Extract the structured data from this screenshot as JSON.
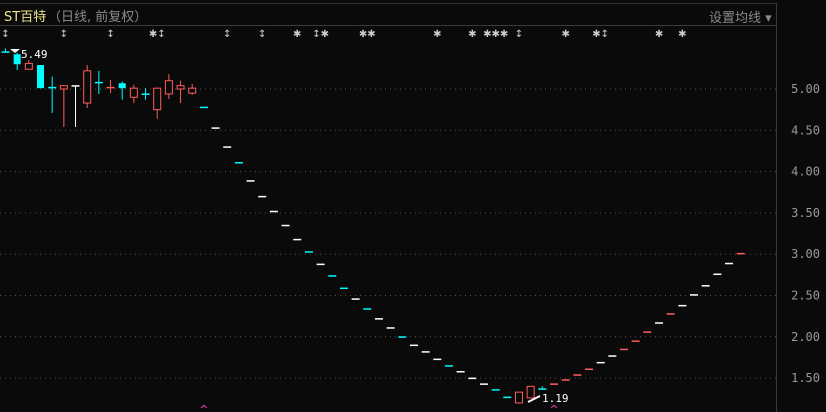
{
  "header": {
    "title": "ST百特",
    "subtitle": "（日线, 前复权）",
    "set_ma": "设置均线 ▾"
  },
  "colors": {
    "up": "#ff5c5c",
    "down": "#00ffff",
    "flat": "#ffffff",
    "grid": "#555555",
    "marker": "#ff40b0"
  },
  "chart_data": {
    "type": "candlestick",
    "yticks": [
      "5.00",
      "4.50",
      "4.00",
      "3.50",
      "3.00",
      "2.50",
      "2.00",
      "1.50"
    ],
    "ylim": [
      1.13,
      5.55
    ],
    "max_label": "5.49",
    "min_label": "1.19",
    "top_markers": [
      "↕",
      "",
      "",
      "",
      "",
      "↕",
      "",
      "",
      "",
      "↕",
      "",
      "",
      "",
      "✱↕",
      "",
      "",
      "",
      "",
      "",
      "↕",
      "",
      "",
      "↕",
      "",
      "",
      "✱",
      "",
      "↕✱",
      "",
      "",
      "",
      "✱✱",
      "",
      "",
      "",
      "",
      "",
      "✱",
      "",
      "",
      "✱",
      "",
      "✱✱✱",
      "",
      "↕",
      "",
      "",
      "",
      "✱",
      "",
      "",
      "✱↕",
      "",
      "",
      "",
      "",
      "✱",
      "",
      "✱",
      "",
      "",
      "",
      "",
      "",
      ""
    ],
    "bottom_markers": [
      17,
      47
    ],
    "candles": [
      [
        5.45,
        5.49,
        5.44,
        5.45,
        "down"
      ],
      [
        5.42,
        5.44,
        5.23,
        5.3,
        "down"
      ],
      [
        5.24,
        5.35,
        5.24,
        5.31,
        "up"
      ],
      [
        5.29,
        5.29,
        5.01,
        5.01,
        "down"
      ],
      [
        5.02,
        5.15,
        4.71,
        5.02,
        "down"
      ],
      [
        5.0,
        5.04,
        4.54,
        5.04,
        "up"
      ],
      [
        5.04,
        5.04,
        4.54,
        5.04,
        "flat"
      ],
      [
        4.83,
        5.29,
        4.77,
        5.22,
        "up"
      ],
      [
        5.08,
        5.22,
        4.94,
        5.08,
        "down"
      ],
      [
        5.02,
        5.11,
        4.95,
        5.02,
        "up"
      ],
      [
        5.07,
        5.09,
        4.87,
        5.01,
        "down"
      ],
      [
        4.9,
        5.05,
        4.83,
        5.01,
        "up"
      ],
      [
        4.94,
        5.01,
        4.87,
        4.94,
        "down"
      ],
      [
        4.75,
        5.01,
        4.64,
        5.01,
        "up"
      ],
      [
        4.94,
        5.18,
        4.88,
        5.1,
        "up"
      ],
      [
        5.0,
        5.1,
        4.83,
        5.04,
        "up"
      ],
      [
        4.95,
        5.06,
        4.93,
        5.01,
        "up"
      ],
      [
        4.78,
        4.78,
        4.78,
        4.78,
        "down"
      ],
      [
        4.53,
        4.53,
        4.53,
        4.53,
        "flat"
      ],
      [
        4.3,
        4.3,
        4.3,
        4.3,
        "flat"
      ],
      [
        4.11,
        4.11,
        4.11,
        4.11,
        "down"
      ],
      [
        3.89,
        3.89,
        3.89,
        3.89,
        "flat"
      ],
      [
        3.7,
        3.7,
        3.7,
        3.7,
        "flat"
      ],
      [
        3.52,
        3.52,
        3.52,
        3.52,
        "flat"
      ],
      [
        3.35,
        3.35,
        3.35,
        3.35,
        "flat"
      ],
      [
        3.18,
        3.18,
        3.18,
        3.18,
        "flat"
      ],
      [
        3.03,
        3.03,
        3.03,
        3.03,
        "down"
      ],
      [
        2.88,
        2.88,
        2.88,
        2.88,
        "flat"
      ],
      [
        2.74,
        2.74,
        2.74,
        2.74,
        "down"
      ],
      [
        2.59,
        2.59,
        2.59,
        2.59,
        "down"
      ],
      [
        2.46,
        2.46,
        2.46,
        2.46,
        "flat"
      ],
      [
        2.34,
        2.34,
        2.34,
        2.34,
        "down"
      ],
      [
        2.22,
        2.22,
        2.22,
        2.22,
        "flat"
      ],
      [
        2.11,
        2.11,
        2.11,
        2.11,
        "flat"
      ],
      [
        2.0,
        2.0,
        2.0,
        2.0,
        "down"
      ],
      [
        1.9,
        1.9,
        1.9,
        1.9,
        "flat"
      ],
      [
        1.82,
        1.82,
        1.82,
        1.82,
        "flat"
      ],
      [
        1.73,
        1.73,
        1.73,
        1.73,
        "flat"
      ],
      [
        1.65,
        1.65,
        1.65,
        1.65,
        "down"
      ],
      [
        1.58,
        1.58,
        1.58,
        1.58,
        "flat"
      ],
      [
        1.5,
        1.5,
        1.5,
        1.5,
        "flat"
      ],
      [
        1.43,
        1.43,
        1.43,
        1.43,
        "flat"
      ],
      [
        1.36,
        1.36,
        1.36,
        1.36,
        "down"
      ],
      [
        1.27,
        1.27,
        1.27,
        1.27,
        "down"
      ],
      [
        1.2,
        1.33,
        1.19,
        1.33,
        "up"
      ],
      [
        1.26,
        1.4,
        1.26,
        1.4,
        "up"
      ],
      [
        1.37,
        1.4,
        1.37,
        1.37,
        "down"
      ],
      [
        1.43,
        1.43,
        1.43,
        1.43,
        "up"
      ],
      [
        1.48,
        1.48,
        1.48,
        1.48,
        "up"
      ],
      [
        1.54,
        1.54,
        1.54,
        1.54,
        "up"
      ],
      [
        1.61,
        1.61,
        1.61,
        1.61,
        "up"
      ],
      [
        1.69,
        1.69,
        1.69,
        1.69,
        "flat"
      ],
      [
        1.77,
        1.77,
        1.77,
        1.77,
        "flat"
      ],
      [
        1.85,
        1.85,
        1.85,
        1.85,
        "up"
      ],
      [
        1.95,
        1.95,
        1.95,
        1.95,
        "up"
      ],
      [
        2.06,
        2.06,
        2.06,
        2.06,
        "up"
      ],
      [
        2.17,
        2.17,
        2.17,
        2.17,
        "flat"
      ],
      [
        2.28,
        2.28,
        2.28,
        2.28,
        "up"
      ],
      [
        2.38,
        2.38,
        2.38,
        2.38,
        "flat"
      ],
      [
        2.51,
        2.51,
        2.51,
        2.51,
        "flat"
      ],
      [
        2.62,
        2.62,
        2.62,
        2.62,
        "flat"
      ],
      [
        2.76,
        2.76,
        2.76,
        2.76,
        "flat"
      ],
      [
        2.89,
        2.89,
        2.89,
        2.89,
        "flat"
      ],
      [
        3.01,
        3.01,
        3.01,
        3.01,
        "up"
      ]
    ]
  }
}
